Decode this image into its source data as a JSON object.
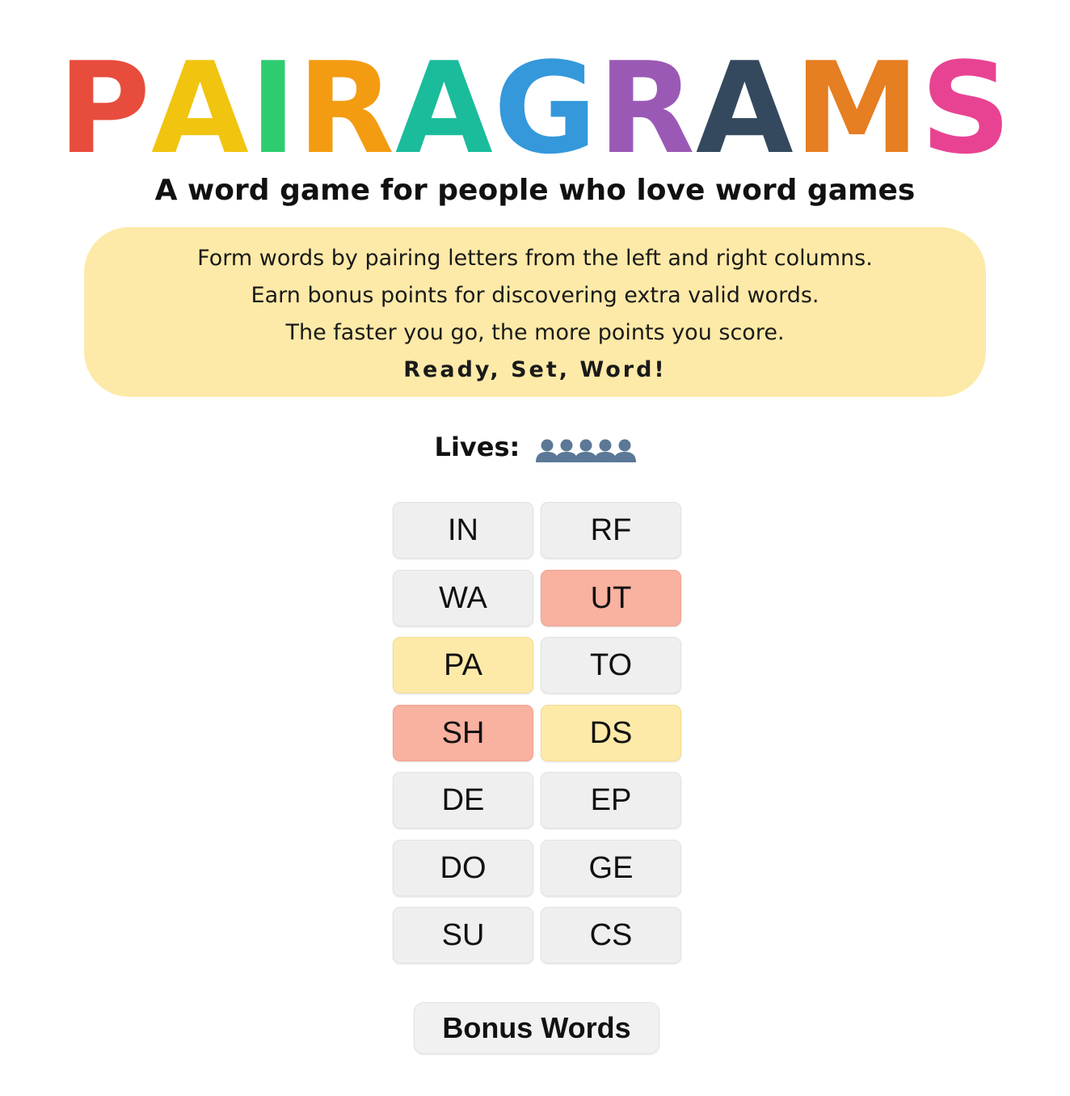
{
  "logo": {
    "letters": [
      {
        "char": "P",
        "color": "#e74c3c"
      },
      {
        "char": "A",
        "color": "#f1c40f"
      },
      {
        "char": "I",
        "color": "#2ecc71"
      },
      {
        "char": "R",
        "color": "#f39c12"
      },
      {
        "char": "A",
        "color": "#1abc9c"
      },
      {
        "char": "G",
        "color": "#3498db"
      },
      {
        "char": "R",
        "color": "#9b59b6"
      },
      {
        "char": "A",
        "color": "#34495e"
      },
      {
        "char": "M",
        "color": "#e67e22"
      },
      {
        "char": "S",
        "color": "#e84393"
      }
    ]
  },
  "tagline": "A word game for people who love word games",
  "intro": {
    "lines": [
      "Form words by pairing letters from the left and right columns.",
      "Earn bonus points for discovering extra valid words.",
      "The faster you go, the more points you score."
    ],
    "ready": "Ready, Set, Word!"
  },
  "lives": {
    "label": "Lives:",
    "count": 5,
    "icon": "bust-in-silhouette-icon",
    "icon_color": "#5b7896"
  },
  "tiles": {
    "left": [
      {
        "text": "IN",
        "state": "default"
      },
      {
        "text": "WA",
        "state": "default"
      },
      {
        "text": "PA",
        "state": "yellow"
      },
      {
        "text": "SH",
        "state": "red"
      },
      {
        "text": "DE",
        "state": "default"
      },
      {
        "text": "DO",
        "state": "default"
      },
      {
        "text": "SU",
        "state": "default"
      }
    ],
    "right": [
      {
        "text": "RF",
        "state": "default"
      },
      {
        "text": "UT",
        "state": "red"
      },
      {
        "text": "TO",
        "state": "default"
      },
      {
        "text": "DS",
        "state": "yellow"
      },
      {
        "text": "EP",
        "state": "default"
      },
      {
        "text": "GE",
        "state": "default"
      },
      {
        "text": "CS",
        "state": "default"
      }
    ]
  },
  "colors": {
    "default": "#efefef",
    "yellow": "#fdeaa8",
    "red": "#f9b1a0"
  },
  "bonus_button": {
    "label": "Bonus Words"
  }
}
